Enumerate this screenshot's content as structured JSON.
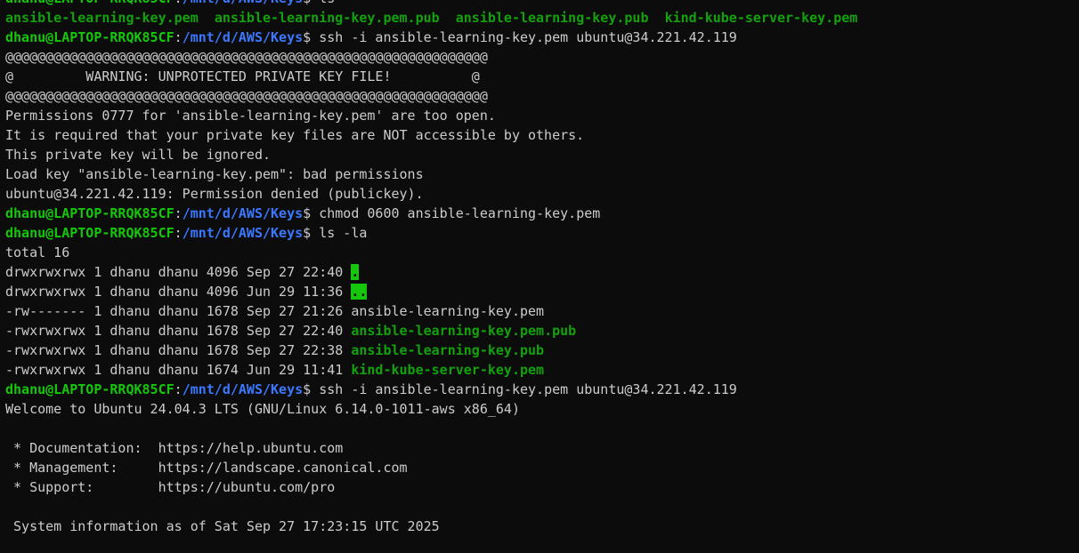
{
  "prompt": {
    "user_host": "dhanu@LAPTOP-RRQK85CF",
    "colon": ":",
    "path": "/mnt/d/AWS/Keys",
    "symbol": "$ "
  },
  "colors": {
    "background": "#0c0c0c",
    "foreground": "#cccccc",
    "prompt_user": "#16c60c",
    "prompt_path": "#3b78ff",
    "directory_entry": "#13a10e",
    "highlight_bg": "#16c60c"
  },
  "lines": [
    {
      "type": "cmd",
      "text": "ls"
    },
    {
      "type": "cols",
      "parts": [
        {
          "text": "ansible-learning-key.pem",
          "style": "dir"
        },
        {
          "text": "  "
        },
        {
          "text": "ansible-learning-key.pem.pub",
          "style": "dir"
        },
        {
          "text": "  "
        },
        {
          "text": "ansible-learning-key.pub",
          "style": "dir"
        },
        {
          "text": "  "
        },
        {
          "text": "kind-kube-server-key.pem",
          "style": "dir"
        }
      ]
    },
    {
      "type": "cmd",
      "text": "ssh -i ansible-learning-key.pem ubuntu@34.221.42.119"
    },
    {
      "type": "out",
      "text": "@@@@@@@@@@@@@@@@@@@@@@@@@@@@@@@@@@@@@@@@@@@@@@@@@@@@@@@@@@@@"
    },
    {
      "type": "out",
      "text": "@         WARNING: UNPROTECTED PRIVATE KEY FILE!          @"
    },
    {
      "type": "out",
      "text": "@@@@@@@@@@@@@@@@@@@@@@@@@@@@@@@@@@@@@@@@@@@@@@@@@@@@@@@@@@@@"
    },
    {
      "type": "out",
      "text": "Permissions 0777 for 'ansible-learning-key.pem' are too open."
    },
    {
      "type": "out",
      "text": "It is required that your private key files are NOT accessible by others."
    },
    {
      "type": "out",
      "text": "This private key will be ignored."
    },
    {
      "type": "out",
      "text": "Load key \"ansible-learning-key.pem\": bad permissions"
    },
    {
      "type": "out",
      "text": "ubuntu@34.221.42.119: Permission denied (publickey)."
    },
    {
      "type": "cmd",
      "text": "chmod 0600 ansible-learning-key.pem"
    },
    {
      "type": "cmd",
      "text": "ls -la"
    },
    {
      "type": "out",
      "text": "total 16"
    },
    {
      "type": "ls",
      "meta": "drwxrwxrwx 1 dhanu dhanu 4096 Sep 27 22:40 ",
      "name": ".",
      "style": "dir-hl"
    },
    {
      "type": "ls",
      "meta": "drwxrwxrwx 1 dhanu dhanu 4096 Jun 29 11:36 ",
      "name": "..",
      "style": "dir-hl"
    },
    {
      "type": "ls",
      "meta": "-rw------- 1 dhanu dhanu 1678 Sep 27 21:26 ",
      "name": "ansible-learning-key.pem",
      "style": "plain"
    },
    {
      "type": "ls",
      "meta": "-rwxrwxrwx 1 dhanu dhanu 1678 Sep 27 22:40 ",
      "name": "ansible-learning-key.pem.pub",
      "style": "dir"
    },
    {
      "type": "ls",
      "meta": "-rwxrwxrwx 1 dhanu dhanu 1678 Sep 27 22:38 ",
      "name": "ansible-learning-key.pub",
      "style": "dir"
    },
    {
      "type": "ls",
      "meta": "-rwxrwxrwx 1 dhanu dhanu 1674 Jun 29 11:41 ",
      "name": "kind-kube-server-key.pem",
      "style": "dir"
    },
    {
      "type": "cmd",
      "text": "ssh -i ansible-learning-key.pem ubuntu@34.221.42.119"
    },
    {
      "type": "out",
      "text": "Welcome to Ubuntu 24.04.3 LTS (GNU/Linux 6.14.0-1011-aws x86_64)"
    },
    {
      "type": "out",
      "text": ""
    },
    {
      "type": "out",
      "text": " * Documentation:  https://help.ubuntu.com"
    },
    {
      "type": "out",
      "text": " * Management:     https://landscape.canonical.com"
    },
    {
      "type": "out",
      "text": " * Support:        https://ubuntu.com/pro"
    },
    {
      "type": "out",
      "text": ""
    },
    {
      "type": "out",
      "text": " System information as of Sat Sep 27 17:23:15 UTC 2025"
    }
  ]
}
